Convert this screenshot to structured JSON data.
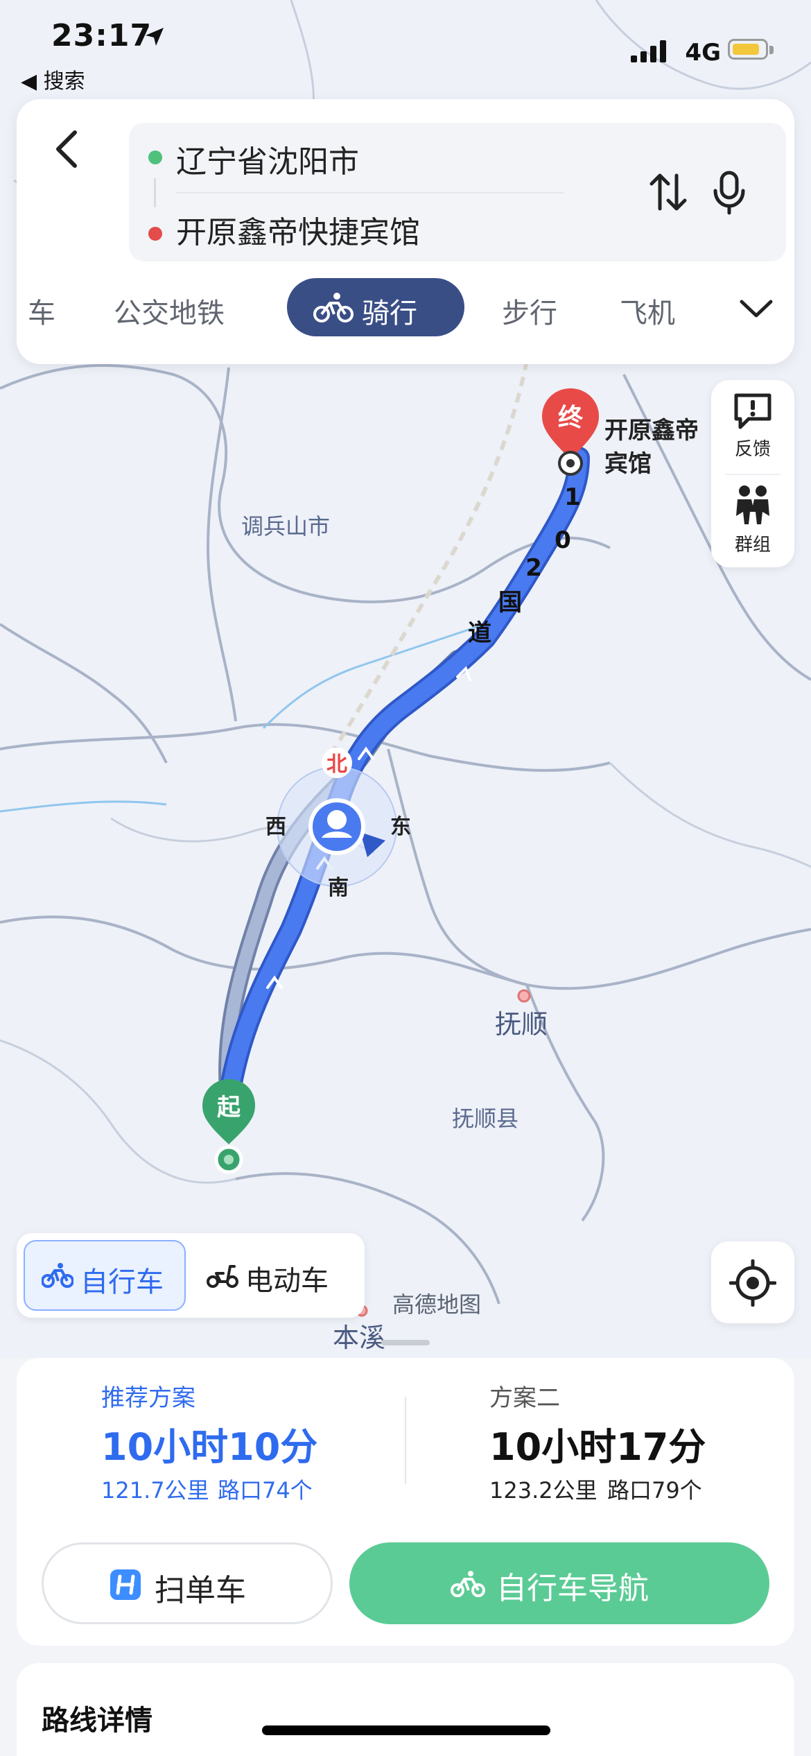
{
  "status_bar": {
    "time": "23:17",
    "back_app": "◀ 搜索",
    "network": "4G"
  },
  "route": {
    "origin": "辽宁省沈阳市",
    "destination": "开原鑫帝快捷宾馆"
  },
  "modes": {
    "car_partial": "车",
    "transit": "公交地铁",
    "cycling": "骑行",
    "walk": "步行",
    "flight": "飞机"
  },
  "side_panel": {
    "feedback": "反馈",
    "group": "群组"
  },
  "map": {
    "end_marker": "终",
    "start_marker": "起",
    "end_label_line1": "开原鑫帝",
    "end_label_line2": "宾馆",
    "road_label": [
      "1",
      "0",
      "2",
      "国",
      "道"
    ],
    "place_tiaobingshan": "调兵山市",
    "place_fushun": "抚顺",
    "place_fushun_county": "抚顺县",
    "place_benxi": "本溪",
    "watermark": "高德地图",
    "compass_n": "北",
    "compass_s": "南",
    "compass_e": "东",
    "compass_w": "西"
  },
  "vehicle_toggle": {
    "bicycle": "自行车",
    "ebike": "电动车",
    "selected": "bicycle"
  },
  "plans": [
    {
      "tag": "推荐方案",
      "duration": "10小时10分",
      "distance": "121.7公里",
      "junctions": "路口74个"
    },
    {
      "tag": "方案二",
      "duration": "10小时17分",
      "distance": "123.2公里",
      "junctions": "路口79个"
    }
  ],
  "actions": {
    "scan_bike": "扫单车",
    "bike_nav": "自行车导航"
  },
  "details": {
    "title": "路线详情"
  },
  "colors": {
    "accent_blue": "#2f6bef",
    "route_blue": "#4a7af0",
    "mode_active": "#3a4e86",
    "nav_green": "#5bcb95",
    "end_red": "#e84a48",
    "start_green": "#39a36d"
  }
}
